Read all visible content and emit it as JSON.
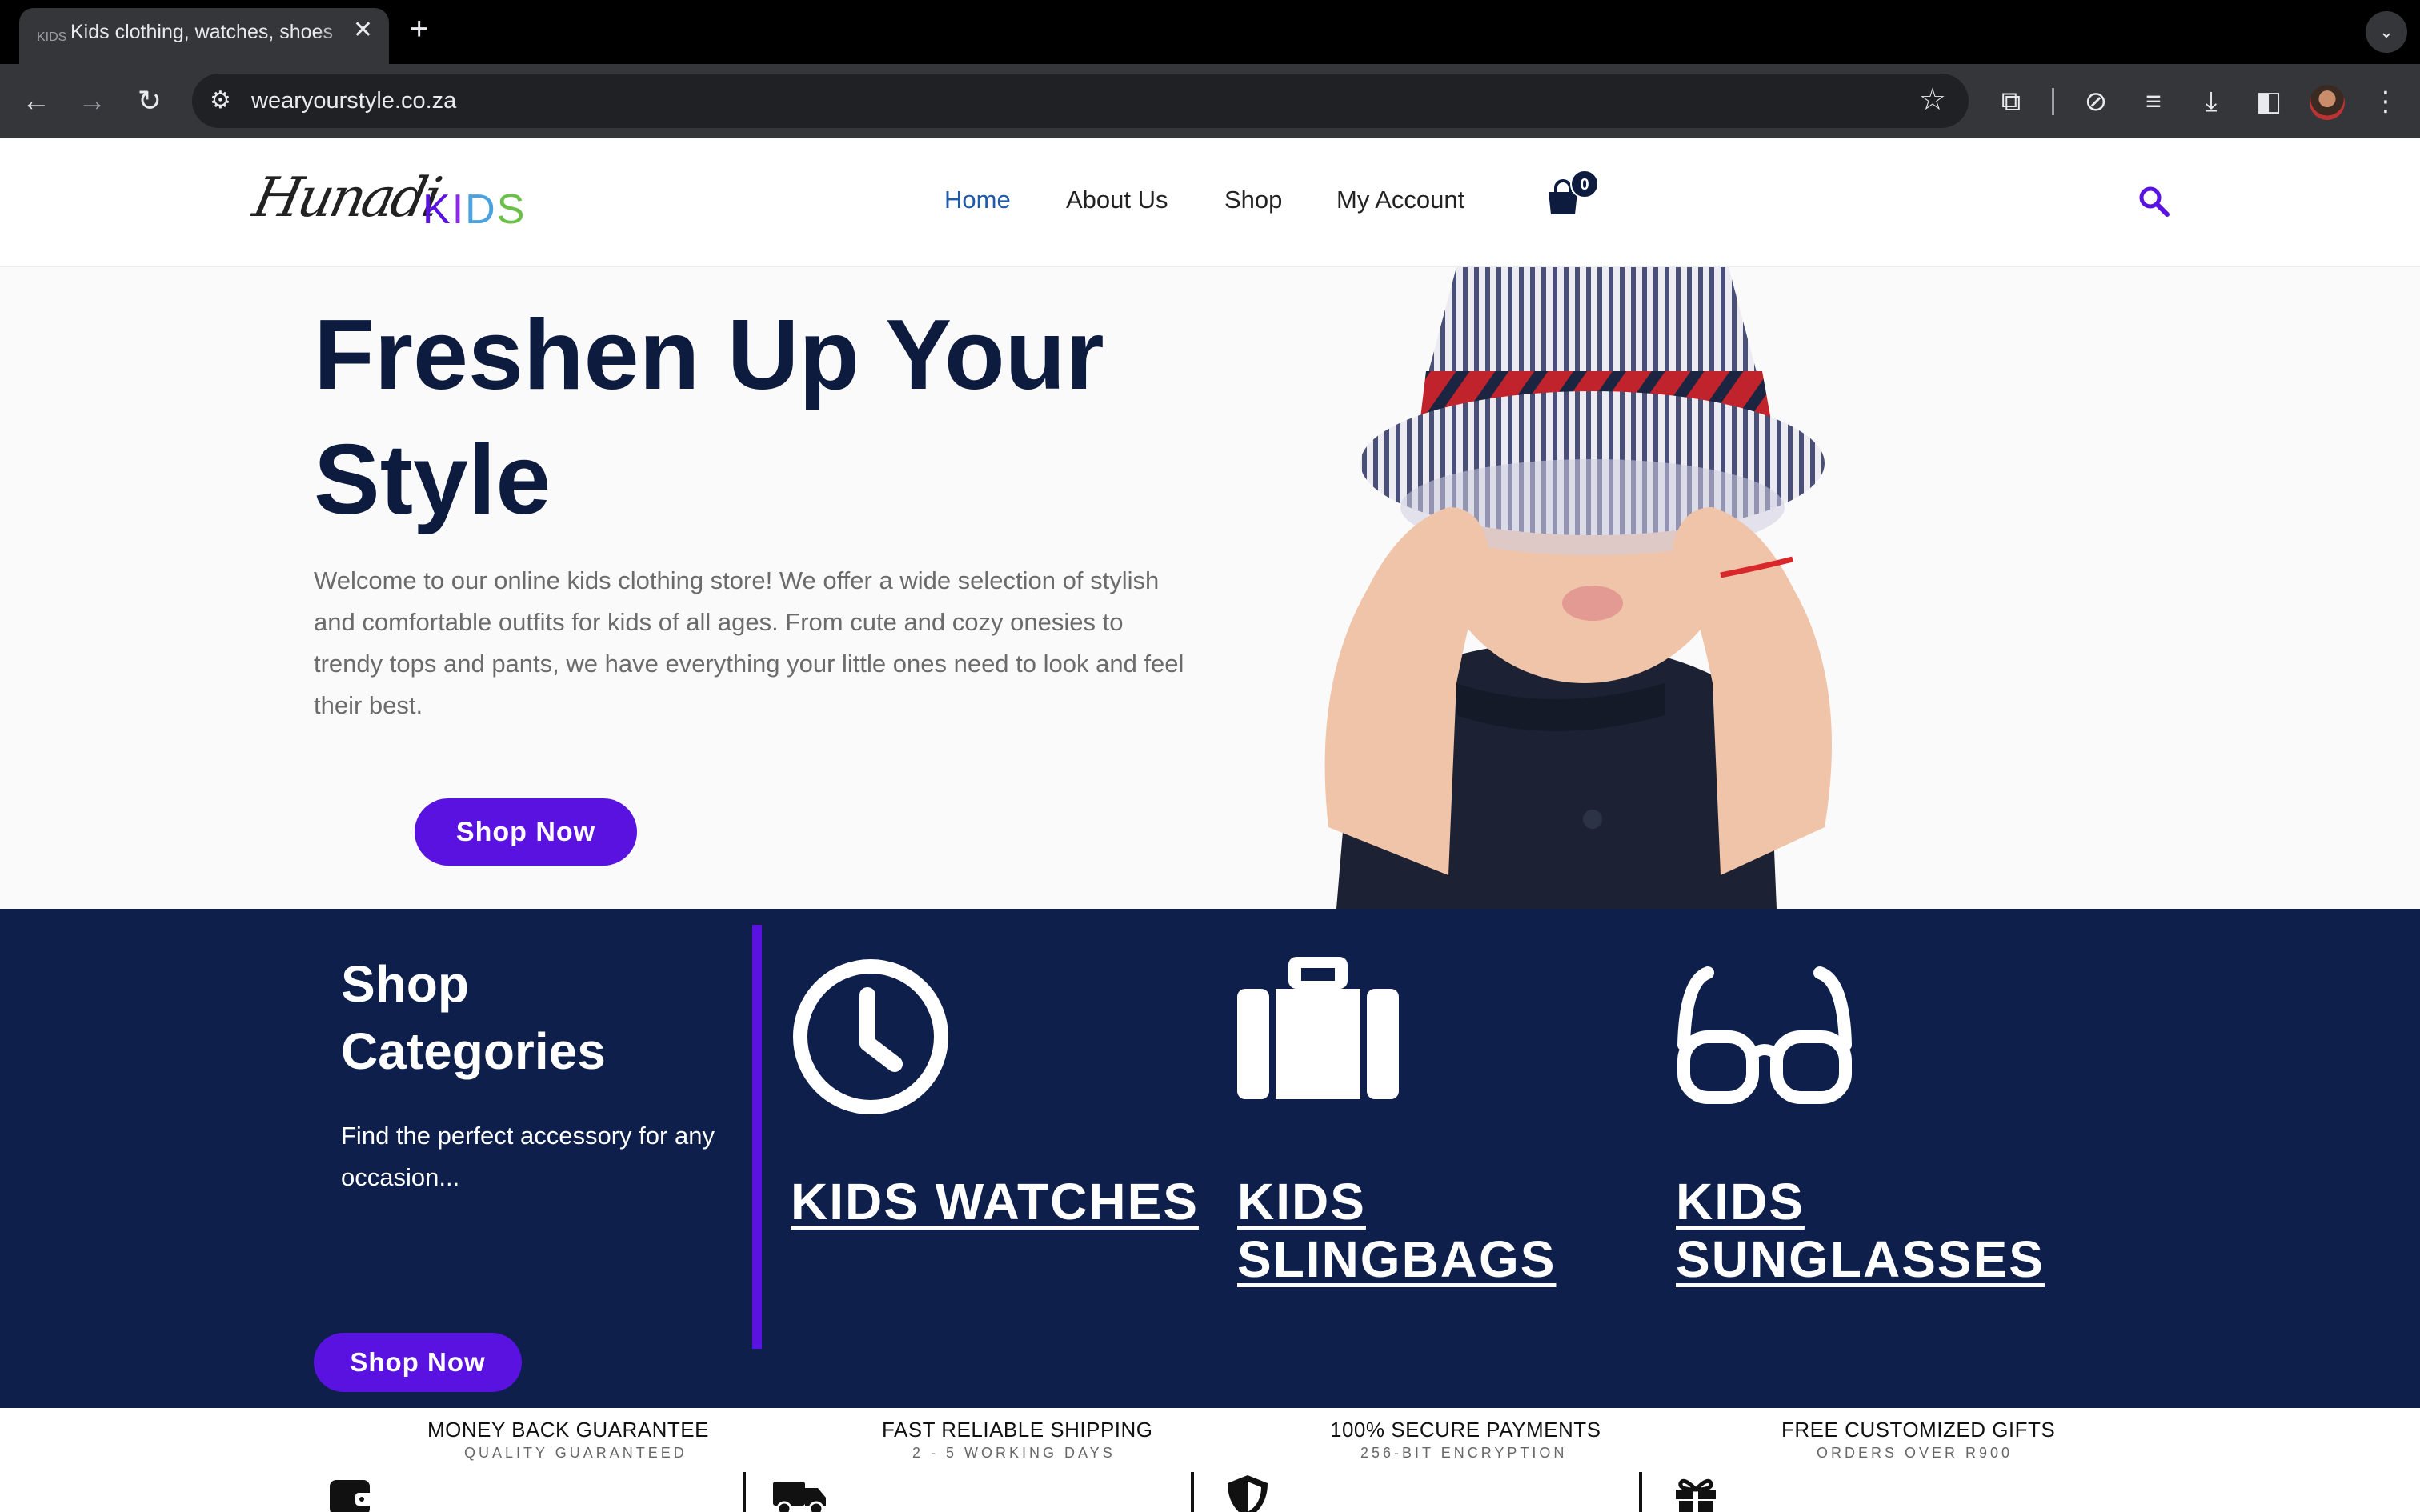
{
  "browser": {
    "tab_title": "Kids clothing, watches, shoes",
    "tab_favicon": "KIDS",
    "url": "wearyourstyle.co.za",
    "icons": [
      "back-icon",
      "forward-icon",
      "reload-icon",
      "site-settings-icon",
      "star-icon",
      "extensions-icon",
      "performance-icon",
      "media-icon",
      "download-icon",
      "sidepanel-icon",
      "menu-icon"
    ]
  },
  "site": {
    "logo_script": "Hunadi",
    "logo_kids": [
      "K",
      "I",
      "D",
      "S"
    ],
    "logo_colors": [
      "#5a12e0",
      "#8a2be2",
      "#4aa3df",
      "#6cc04a"
    ],
    "nav": [
      {
        "label": "Home",
        "active": true
      },
      {
        "label": "About Us"
      },
      {
        "label": "Shop"
      },
      {
        "label": "My Account"
      }
    ],
    "cart_count": "0"
  },
  "hero": {
    "title": "Freshen Up Your Style",
    "text": "Welcome to our online kids clothing store! We offer a wide selection of stylish and comfortable outfits for kids of all ages. From cute and cozy onesies to trendy tops and pants, we have everything your little ones need to look and feel their best.",
    "button": "Shop Now"
  },
  "categories": {
    "title": "Shop Categories",
    "description": "Find the perfect accessory for any occasion...",
    "button": "Shop Now",
    "items": [
      {
        "label": "KIDS WATCHES",
        "icon": "clock-icon"
      },
      {
        "label": "KIDS SLINGBAGS",
        "icon": "bag-icon"
      },
      {
        "label": "KIDS SUNGLASSES",
        "icon": "glasses-icon"
      }
    ]
  },
  "features": [
    {
      "title": "MONEY BACK GUARANTEE",
      "sub": "QUALITY GUARANTEED",
      "icon": "wallet-icon"
    },
    {
      "title": "FAST RELIABLE SHIPPING",
      "sub": "2 - 5 WORKING DAYS",
      "icon": "truck-icon"
    },
    {
      "title": "100% SECURE PAYMENTS",
      "sub": "256-BIT ENCRYPTION",
      "icon": "shield-icon"
    },
    {
      "title": "FREE CUSTOMIZED GIFTS",
      "sub": "ORDERS OVER R900",
      "icon": "gift-icon"
    }
  ],
  "colors": {
    "navy": "#0d1f4a",
    "purple": "#5a12e0",
    "nav_active": "#1f5ba8"
  }
}
